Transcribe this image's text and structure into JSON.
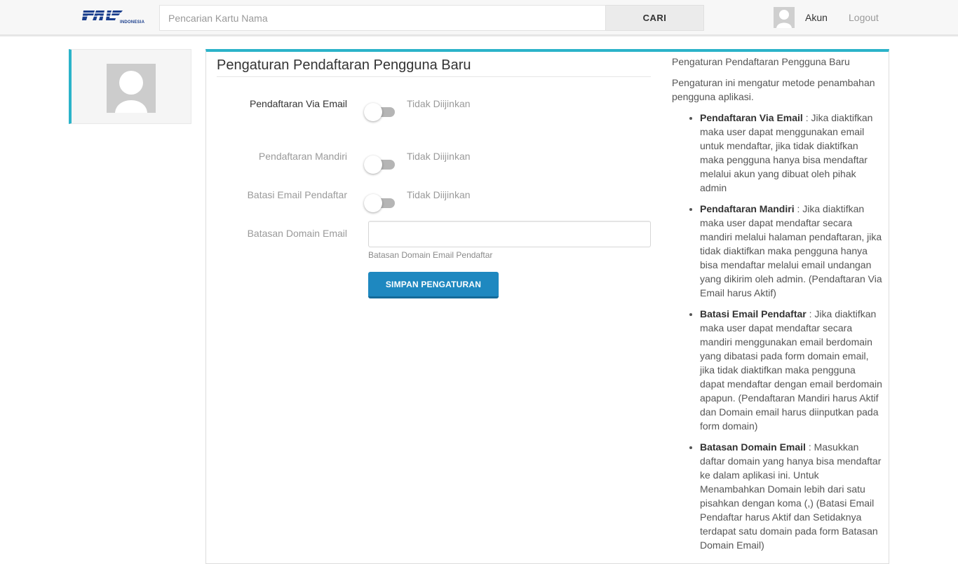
{
  "header": {
    "logo_text": "PAL",
    "logo_subtext": "INDONESIA",
    "search_placeholder": "Pencarian Kartu Nama",
    "search_button": "CARI",
    "account_label": "Akun",
    "logout_label": "Logout"
  },
  "colors": {
    "accent": "#2bb3c9",
    "primary_button": "#1e88c0",
    "logo_blue": "#1a3e8c"
  },
  "form": {
    "title": "Pengaturan Pendaftaran Pengguna Baru",
    "fields": [
      {
        "label": "Pendaftaran Via Email",
        "state": "Tidak Diijinkan",
        "enabled": false
      },
      {
        "label": "Pendaftaran Mandiri",
        "state": "Tidak Diijinkan",
        "enabled": false
      },
      {
        "label": "Batasi Email Pendaftar",
        "state": "Tidak Diijinkan",
        "enabled": false
      }
    ],
    "domain_label": "Batasan Domain Email",
    "domain_value": "",
    "domain_help": "Batasan Domain Email Pendaftar",
    "save_button": "SIMPAN PENGATURAN"
  },
  "help": {
    "title": "Pengaturan Pendaftaran Pengguna Baru",
    "intro": "Pengaturan ini mengatur metode penambahan pengguna aplikasi.",
    "items": [
      {
        "term": "Pendaftaran Via Email",
        "desc": " : Jika diaktifkan maka user dapat menggunakan email untuk mendaftar, jika tidak diaktifkan maka pengguna hanya bisa mendaftar melalui akun yang dibuat oleh pihak admin"
      },
      {
        "term": "Pendaftaran Mandiri",
        "desc": " : Jika diaktifkan maka user dapat mendaftar secara mandiri melalui halaman pendaftaran, jika tidak diaktifkan maka pengguna hanya bisa mendaftar melalui email undangan yang dikirim oleh admin. (Pendaftaran Via Email harus Aktif)"
      },
      {
        "term": "Batasi Email Pendaftar",
        "desc": " : Jika diaktifkan maka user dapat mendaftar secara mandiri menggunakan email berdomain yang dibatasi pada form domain email, jika tidak diaktifkan maka pengguna dapat mendaftar dengan email berdomain apapun. (Pendaftaran Mandiri harus Aktif dan Domain email harus diinputkan pada form domain)"
      },
      {
        "term": "Batasan Domain Email",
        "desc": " : Masukkan daftar domain yang hanya bisa mendaftar ke dalam aplikasi ini. Untuk Menambahkan Domain lebih dari satu pisahkan dengan koma (,) (Batasi Email Pendaftar harus Aktif dan Setidaknya terdapat satu domain pada form Batasan Domain Email)"
      }
    ]
  }
}
